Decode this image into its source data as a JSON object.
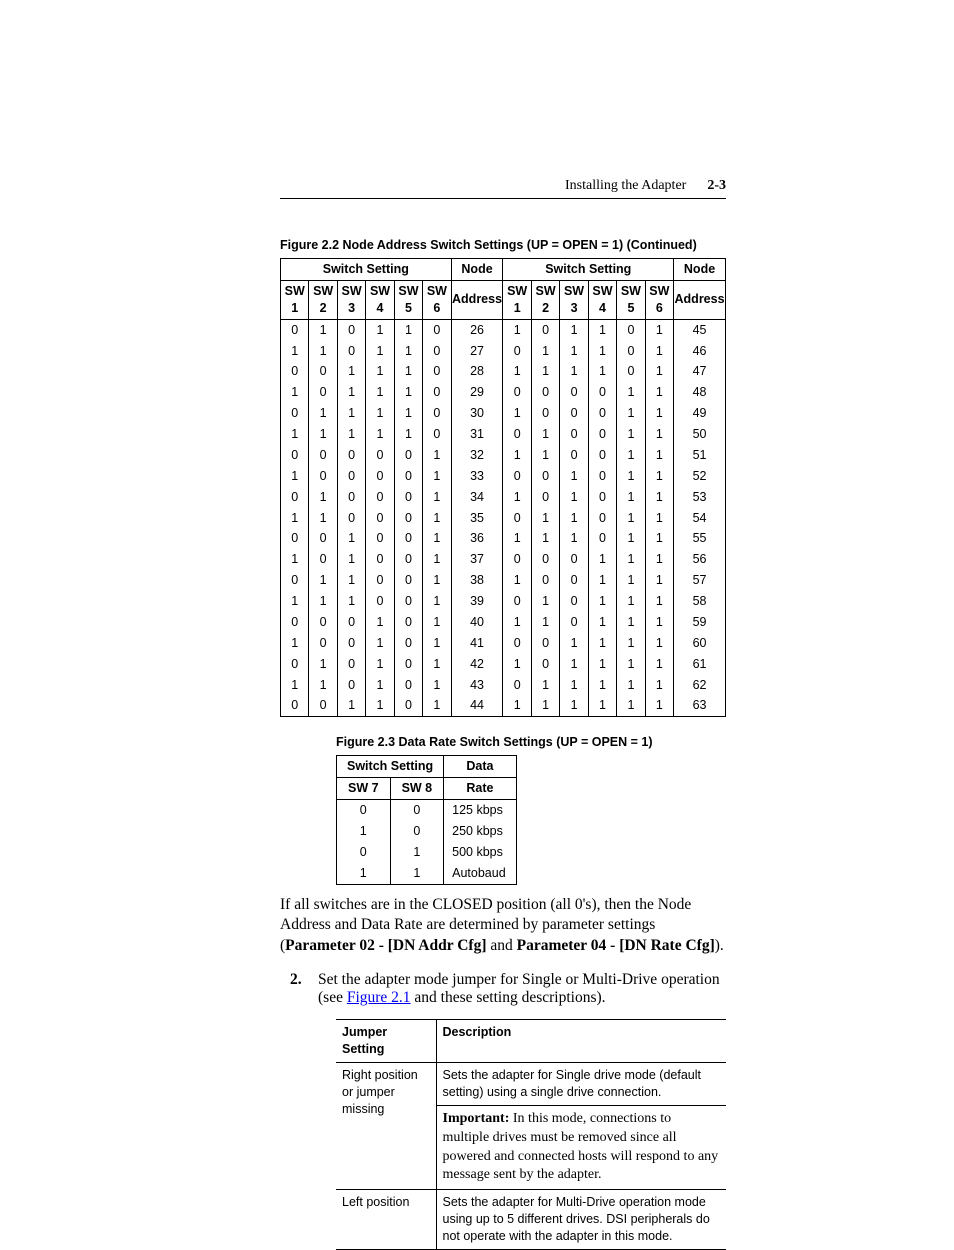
{
  "header": {
    "section": "Installing the Adapter",
    "page": "2-3"
  },
  "fig22": {
    "caption": "Figure 2.2   Node Address Switch Settings (UP = OPEN = 1) (Continued)",
    "group": "Switch Setting",
    "node": "Node",
    "addr": "Address",
    "cols": [
      "SW 1",
      "SW 2",
      "SW 3",
      "SW 4",
      "SW 5",
      "SW 6"
    ],
    "left": [
      [
        "0",
        "1",
        "0",
        "1",
        "1",
        "0",
        "26"
      ],
      [
        "1",
        "1",
        "0",
        "1",
        "1",
        "0",
        "27"
      ],
      [
        "0",
        "0",
        "1",
        "1",
        "1",
        "0",
        "28"
      ],
      [
        "1",
        "0",
        "1",
        "1",
        "1",
        "0",
        "29"
      ],
      [
        "0",
        "1",
        "1",
        "1",
        "1",
        "0",
        "30"
      ],
      [
        "1",
        "1",
        "1",
        "1",
        "1",
        "0",
        "31"
      ],
      [
        "0",
        "0",
        "0",
        "0",
        "0",
        "1",
        "32"
      ],
      [
        "1",
        "0",
        "0",
        "0",
        "0",
        "1",
        "33"
      ],
      [
        "0",
        "1",
        "0",
        "0",
        "0",
        "1",
        "34"
      ],
      [
        "1",
        "1",
        "0",
        "0",
        "0",
        "1",
        "35"
      ],
      [
        "0",
        "0",
        "1",
        "0",
        "0",
        "1",
        "36"
      ],
      [
        "1",
        "0",
        "1",
        "0",
        "0",
        "1",
        "37"
      ],
      [
        "0",
        "1",
        "1",
        "0",
        "0",
        "1",
        "38"
      ],
      [
        "1",
        "1",
        "1",
        "0",
        "0",
        "1",
        "39"
      ],
      [
        "0",
        "0",
        "0",
        "1",
        "0",
        "1",
        "40"
      ],
      [
        "1",
        "0",
        "0",
        "1",
        "0",
        "1",
        "41"
      ],
      [
        "0",
        "1",
        "0",
        "1",
        "0",
        "1",
        "42"
      ],
      [
        "1",
        "1",
        "0",
        "1",
        "0",
        "1",
        "43"
      ],
      [
        "0",
        "0",
        "1",
        "1",
        "0",
        "1",
        "44"
      ]
    ],
    "right": [
      [
        "1",
        "0",
        "1",
        "1",
        "0",
        "1",
        "45"
      ],
      [
        "0",
        "1",
        "1",
        "1",
        "0",
        "1",
        "46"
      ],
      [
        "1",
        "1",
        "1",
        "1",
        "0",
        "1",
        "47"
      ],
      [
        "0",
        "0",
        "0",
        "0",
        "1",
        "1",
        "48"
      ],
      [
        "1",
        "0",
        "0",
        "0",
        "1",
        "1",
        "49"
      ],
      [
        "0",
        "1",
        "0",
        "0",
        "1",
        "1",
        "50"
      ],
      [
        "1",
        "1",
        "0",
        "0",
        "1",
        "1",
        "51"
      ],
      [
        "0",
        "0",
        "1",
        "0",
        "1",
        "1",
        "52"
      ],
      [
        "1",
        "0",
        "1",
        "0",
        "1",
        "1",
        "53"
      ],
      [
        "0",
        "1",
        "1",
        "0",
        "1",
        "1",
        "54"
      ],
      [
        "1",
        "1",
        "1",
        "0",
        "1",
        "1",
        "55"
      ],
      [
        "0",
        "0",
        "0",
        "1",
        "1",
        "1",
        "56"
      ],
      [
        "1",
        "0",
        "0",
        "1",
        "1",
        "1",
        "57"
      ],
      [
        "0",
        "1",
        "0",
        "1",
        "1",
        "1",
        "58"
      ],
      [
        "1",
        "1",
        "0",
        "1",
        "1",
        "1",
        "59"
      ],
      [
        "0",
        "0",
        "1",
        "1",
        "1",
        "1",
        "60"
      ],
      [
        "1",
        "0",
        "1",
        "1",
        "1",
        "1",
        "61"
      ],
      [
        "0",
        "1",
        "1",
        "1",
        "1",
        "1",
        "62"
      ],
      [
        "1",
        "1",
        "1",
        "1",
        "1",
        "1",
        "63"
      ]
    ]
  },
  "fig23": {
    "caption": "Figure 2.3   Data Rate Switch Settings (UP = OPEN = 1)",
    "group": "Switch Setting",
    "data": "Data",
    "rate": "Rate",
    "cols": [
      "SW 7",
      "SW 8"
    ],
    "rows": [
      [
        "0",
        "0",
        "125 kbps"
      ],
      [
        "1",
        "0",
        "250 kbps"
      ],
      [
        "0",
        "1",
        "500 kbps"
      ],
      [
        "1",
        "1",
        "Autobaud"
      ]
    ]
  },
  "body": {
    "p1a": "If all switches are in the CLOSED position (all 0's), then the Node Address and Data Rate are determined by parameter settings (",
    "p1b": "Parameter 02 - [DN Addr Cfg]",
    "p1c": " and ",
    "p1d": "Parameter 04 - [DN Rate Cfg]",
    "p1e": ").",
    "step_num": "2.",
    "step_a": "Set the adapter mode jumper for Single or Multi-Drive operation (see ",
    "step_link": "Figure 2.1",
    "step_b": " and these setting descriptions)."
  },
  "jumper": {
    "h1": "Jumper Setting",
    "h2": "Description",
    "r1a": "Right position or jumper missing",
    "r1b": "Sets the adapter for Single drive mode (default setting) using a single drive connection.",
    "r1c_lead": "Important:",
    "r1c": "   In this mode, connections to multiple drives must be removed since all powered and connected hosts will respond to any message sent by the adapter.",
    "r2a": "Left position",
    "r2b": "Sets the adapter for Multi-Drive operation mode using up to 5 different drives. DSI peripherals do not operate with the adapter in this mode."
  }
}
